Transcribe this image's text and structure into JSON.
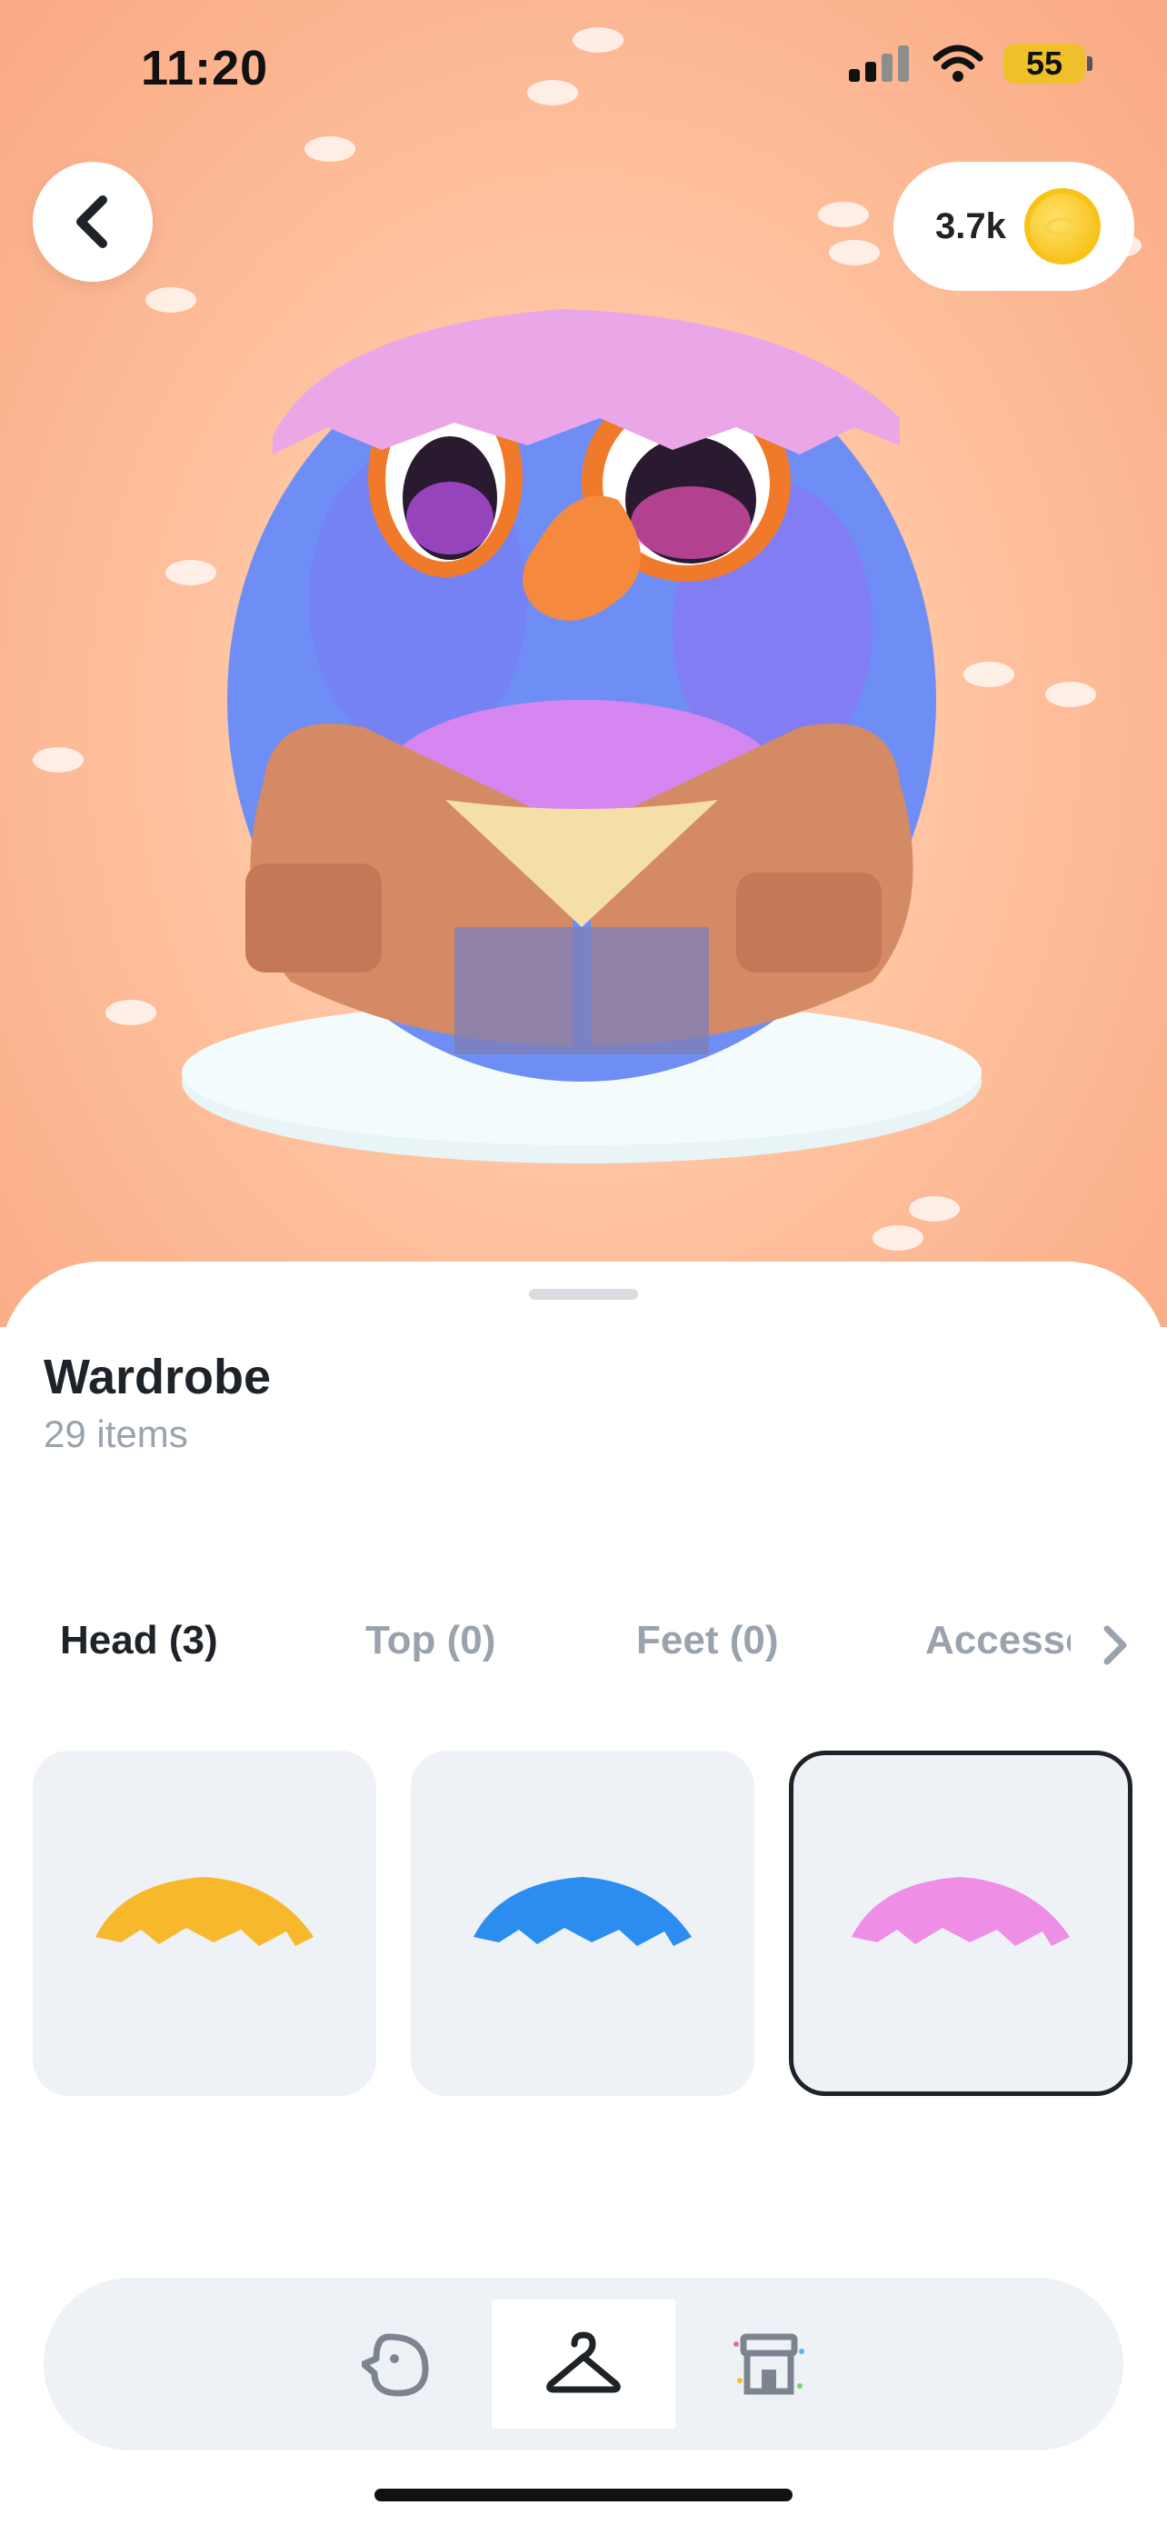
{
  "status": {
    "time": "11:20",
    "battery": "55"
  },
  "header": {
    "coins": "3.7k"
  },
  "wardrobe": {
    "title": "Wardrobe",
    "count": "29 items"
  },
  "tabs": [
    {
      "label": "Head (3)"
    },
    {
      "label": "Top (0)"
    },
    {
      "label": "Feet (0)"
    },
    {
      "label": "Accessories"
    }
  ],
  "items": [
    {
      "icon": "eggshell-hat-yellow-icon",
      "color": "#f7b92b"
    },
    {
      "icon": "eggshell-hat-blue-icon",
      "color": "#2b8df0"
    },
    {
      "icon": "eggshell-hat-pink-icon",
      "color": "#ee8ee6"
    }
  ],
  "nav": [
    {
      "icon": "bird-icon"
    },
    {
      "icon": "hanger-icon"
    },
    {
      "icon": "shop-icon"
    }
  ],
  "colors": {
    "accent": "#1e2229",
    "muted": "#9aa3ad",
    "panel": "#eef2f6"
  }
}
